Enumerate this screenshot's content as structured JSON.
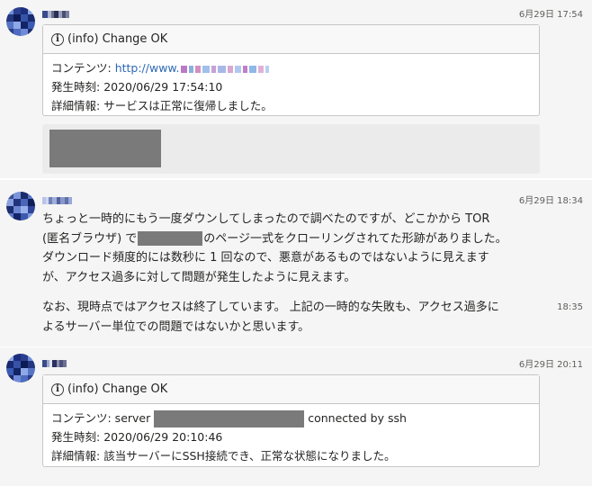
{
  "messages": [
    {
      "sender": "T. Kagi",
      "time": "6月29日 17:54",
      "card": {
        "title": "(info) Change OK",
        "content_label": "コンテンツ: ",
        "content_value": "http://www.",
        "occurred_label": "発生時刻: ",
        "occurred_value": "2020/06/29 17:54:10",
        "detail_label": "詳細情報: ",
        "detail_value": "サービスは正常に復帰しました。"
      }
    },
    {
      "sender": "Kagi",
      "time": "6月29日 18:34",
      "line1": "ちょっと一時的にもう一度ダウンしてしまったので調べたのですが、どこかから TOR",
      "line2_a": "(匿名ブラウザ) で",
      "line2_b": "のページ一式をクローリングされてた形跡がありました。",
      "line3": "ダウンロード頻度的には数秒に 1 回なので、悪意があるものではないように見えます",
      "line4": "が、アクセス過多に対して問題が発生したように見えます。",
      "line5": "なお、現時点ではアクセスは終了しています。 上記の一時的な失敗も、アクセス過多に",
      "line6": "よるサーバー単位での問題ではないかと思います。",
      "time2": "18:35"
    },
    {
      "sender": "T. Kagi",
      "time": "6月29日 20:11",
      "card": {
        "title": "(info) Change OK",
        "content_label": "コンテンツ: server ",
        "content_suffix": " connected by ssh",
        "occurred_label": "発生時刻: ",
        "occurred_value": "2020/06/29 20:10:46",
        "detail_label": "詳細情報: ",
        "detail_value": "該当サーバーにSSH接続でき、正常な状態になりました。"
      }
    }
  ]
}
